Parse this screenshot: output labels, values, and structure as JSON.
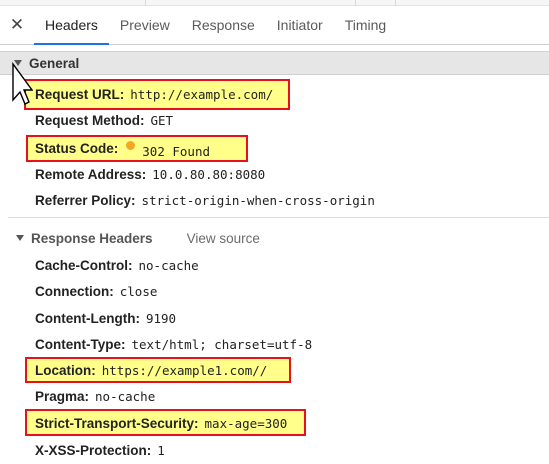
{
  "tabs": {
    "close_glyph": "✕",
    "items": [
      "Headers",
      "Preview",
      "Response",
      "Initiator",
      "Timing"
    ],
    "active": "Headers"
  },
  "general": {
    "title": "General",
    "rows": [
      {
        "key": "Request URL:",
        "value": "http://example.com/"
      },
      {
        "key": "Request Method:",
        "value": "GET"
      },
      {
        "key": "Status Code:",
        "value": "302 Found"
      },
      {
        "key": "Remote Address:",
        "value": "10.0.80.80:8080"
      },
      {
        "key": "Referrer Policy:",
        "value": "strict-origin-when-cross-origin"
      }
    ]
  },
  "response_headers": {
    "title": "Response Headers",
    "view_source": "View source",
    "rows": [
      {
        "key": "Cache-Control:",
        "value": "no-cache"
      },
      {
        "key": "Connection:",
        "value": "close"
      },
      {
        "key": "Content-Length:",
        "value": "9190"
      },
      {
        "key": "Content-Type:",
        "value": "text/html; charset=utf-8"
      },
      {
        "key": "Location:",
        "value": "https://example1.com//"
      },
      {
        "key": "Pragma:",
        "value": "no-cache"
      },
      {
        "key": "Strict-Transport-Security:",
        "value": "max-age=300"
      },
      {
        "key": "X-XSS-Protection:",
        "value": "1"
      }
    ]
  },
  "colors": {
    "highlight_fill": "#ffff8a",
    "highlight_border": "#e8111b",
    "status_dot": "#f5a623",
    "active_tab_underline": "#1a73e8"
  }
}
